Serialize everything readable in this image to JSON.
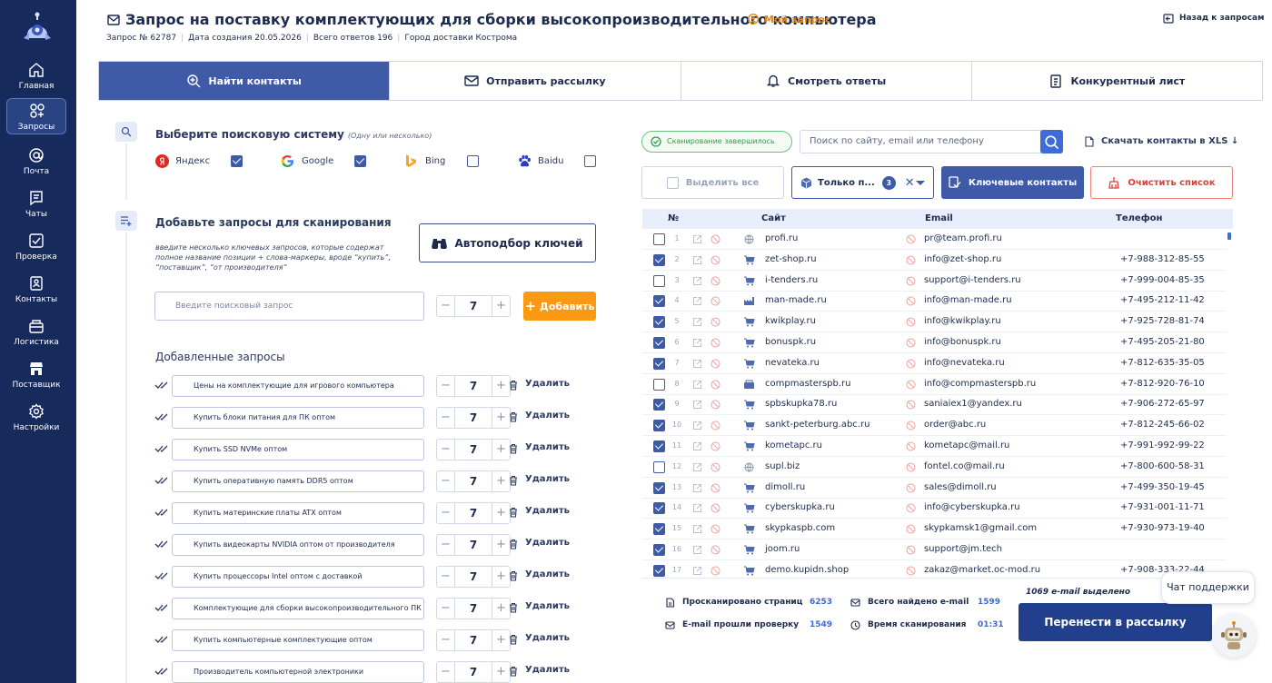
{
  "nav": [
    {
      "label": "Главная",
      "icon": "home-icon"
    },
    {
      "label": "Запросы",
      "icon": "requests-icon"
    },
    {
      "label": "Почта",
      "icon": "mail-icon"
    },
    {
      "label": "Чаты",
      "icon": "chat-icon"
    },
    {
      "label": "Проверка",
      "icon": "check-icon"
    },
    {
      "label": "Контакты",
      "icon": "contacts-icon"
    },
    {
      "label": "Логистика",
      "icon": "logistics-icon"
    },
    {
      "label": "Поставщик",
      "icon": "supplier-icon"
    },
    {
      "label": "Настройки",
      "icon": "settings-icon"
    }
  ],
  "header": {
    "title": "Запрос на поставку комплектующих для сборки высокопроизводительного компьютера",
    "my_request": "Мой запрос",
    "back": "Назад к запросам",
    "meta": [
      "Запрос № 62787",
      "Дата создания 20.05.2026",
      "Всего ответов 196",
      "Город доставки Кострома"
    ]
  },
  "tabs": [
    {
      "label": "Найти контакты",
      "active": true
    },
    {
      "label": "Отправить рассылку"
    },
    {
      "label": "Смотреть ответы"
    },
    {
      "label": "Конкурентный лист"
    }
  ],
  "engines": {
    "title": "Выберите поисковую систему",
    "hint": "(Одну или несколько)",
    "items": [
      {
        "name": "Яндекс",
        "checked": true
      },
      {
        "name": "Google",
        "checked": true
      },
      {
        "name": "Bing",
        "checked": false
      },
      {
        "name": "Baidu",
        "checked": false
      }
    ]
  },
  "queries": {
    "title": "Добавьте запросы для сканирования",
    "hint": "введите несколько ключевых запросов, которые содержат полное название позиции + слова-маркеры, вроде “купить”, “поставщик”, “от производителя”",
    "autoselect": "Автоподбор ключей",
    "placeholder": "Введите поисковый запрос",
    "stepper_value": "7",
    "add": "Добавить",
    "added_title": "Добавленные запросы",
    "delete_label": "Удалить",
    "items": [
      {
        "text": "Цены на комплектующие для игрового компьютера",
        "value": "7"
      },
      {
        "text": "Купить блоки питания для ПК оптом",
        "value": "7"
      },
      {
        "text": "Купить SSD NVMe оптом",
        "value": "7"
      },
      {
        "text": "Купить оперативную память DDR5 оптом",
        "value": "7"
      },
      {
        "text": "Купить материнские платы ATX оптом",
        "value": "7"
      },
      {
        "text": "Купить видеокарты NVIDIA оптом от производителя",
        "value": "7"
      },
      {
        "text": "Купить процессоры Intel оптом с доставкой",
        "value": "7"
      },
      {
        "text": "Комплектующие для сборки высокопроизводительного ПК",
        "value": "7"
      },
      {
        "text": "Купить компьютерные комплектующие оптом",
        "value": "7"
      },
      {
        "text": "Производитель компьютерной электроники",
        "value": "7"
      }
    ]
  },
  "results": {
    "status": "Сканирование завершилось",
    "search_placeholder": "Поиск по сайту, email или телефону",
    "download": "Скачать контакты в XLS ↓",
    "select_all": "Выделить все",
    "filter_label": "Только п...",
    "filter_count": "3",
    "key_contacts": "Ключевые контакты",
    "clear": "Очистить  список",
    "columns": {
      "num": "№",
      "site": "Сайт",
      "email": "Email",
      "phone": "Телефон"
    },
    "rows": [
      {
        "n": "1",
        "site": "profi.ru",
        "email": "pr@team.profi.ru",
        "phone": "",
        "checked": false,
        "icon": "globe-icon"
      },
      {
        "n": "2",
        "site": "zet-shop.ru",
        "email": "info@zet-shop.ru",
        "phone": "+7-988-312-85-55",
        "checked": true,
        "icon": "cart-icon"
      },
      {
        "n": "3",
        "site": "i-tenders.ru",
        "email": "support@i-tenders.ru",
        "phone": "+7-999-004-85-35",
        "checked": false,
        "icon": "cart-icon"
      },
      {
        "n": "4",
        "site": "man-made.ru",
        "email": "info@man-made.ru",
        "phone": "+7-495-212-11-42",
        "checked": true,
        "icon": "factory-icon"
      },
      {
        "n": "5",
        "site": "kwikplay.ru",
        "email": "info@kwikplay.ru",
        "phone": "+7-925-728-81-74",
        "checked": true,
        "icon": "cart-icon"
      },
      {
        "n": "6",
        "site": "bonuspk.ru",
        "email": "info@bonuspk.ru",
        "phone": "+7-495-205-21-80",
        "checked": true,
        "icon": "cart-icon"
      },
      {
        "n": "7",
        "site": "nevateka.ru",
        "email": "info@nevateka.ru",
        "phone": "+7-812-635-35-05",
        "checked": true,
        "icon": "cart-icon"
      },
      {
        "n": "8",
        "site": "compmasterspb.ru",
        "email": "info@compmasterspb.ru",
        "phone": "+7-812-920-76-10",
        "checked": false,
        "icon": "box-icon"
      },
      {
        "n": "9",
        "site": "spbskupka78.ru",
        "email": "saniaiex1@yandex.ru",
        "phone": "+7-906-272-65-97",
        "checked": true,
        "icon": "cart-icon"
      },
      {
        "n": "10",
        "site": "sankt-peterburg.abc.ru",
        "email": "order@abc.ru",
        "phone": "+7-812-245-66-02",
        "checked": true,
        "icon": "cart-icon"
      },
      {
        "n": "11",
        "site": "kometapc.ru",
        "email": "kometapc@mail.ru",
        "phone": "+7-991-992-99-22",
        "checked": true,
        "icon": "cart-icon"
      },
      {
        "n": "12",
        "site": "supl.biz",
        "email": "fontel.co@mail.ru",
        "phone": "+7-800-600-58-31",
        "checked": false,
        "icon": "globe-icon"
      },
      {
        "n": "13",
        "site": "dimoll.ru",
        "email": "sales@dimoll.ru",
        "phone": "+7-499-350-19-45",
        "checked": true,
        "icon": "cart-icon"
      },
      {
        "n": "14",
        "site": "cyberskupka.ru",
        "email": "info@cyberskupka.ru",
        "phone": "+7-931-001-11-71",
        "checked": true,
        "icon": "cart-icon"
      },
      {
        "n": "15",
        "site": "skypkaspb.com",
        "email": "skypkamsk1@gmail.com",
        "phone": "+7-930-973-19-40",
        "checked": true,
        "icon": "cart-icon"
      },
      {
        "n": "16",
        "site": "joom.ru",
        "email": "support@jm.tech",
        "phone": "",
        "checked": true,
        "icon": "cart-icon"
      },
      {
        "n": "17",
        "site": "demo.kupidn.shop",
        "email": "zakaz@market.oc-mod.ru",
        "phone": "+7-908-333-22-44",
        "checked": true,
        "icon": "cart-icon"
      }
    ],
    "stats": {
      "pages_label": "Просканировано страниц",
      "pages_value": "6253",
      "emails_label": "Всего найдено e-mail",
      "emails_value": "1599",
      "checked_label": "E-mail прошли проверку",
      "checked_value": "1549",
      "time_label": "Время сканирования",
      "time_value": "01:31"
    },
    "selected": "1069 e-mail выделено",
    "transfer": "Перенести в рассылку"
  },
  "support": {
    "label": "Чат поддержки"
  },
  "colors": {
    "sidebar": "#162a5c",
    "accent": "#3f5ba8",
    "orange": "#f99a12",
    "primary_btn": "#213f8c"
  }
}
